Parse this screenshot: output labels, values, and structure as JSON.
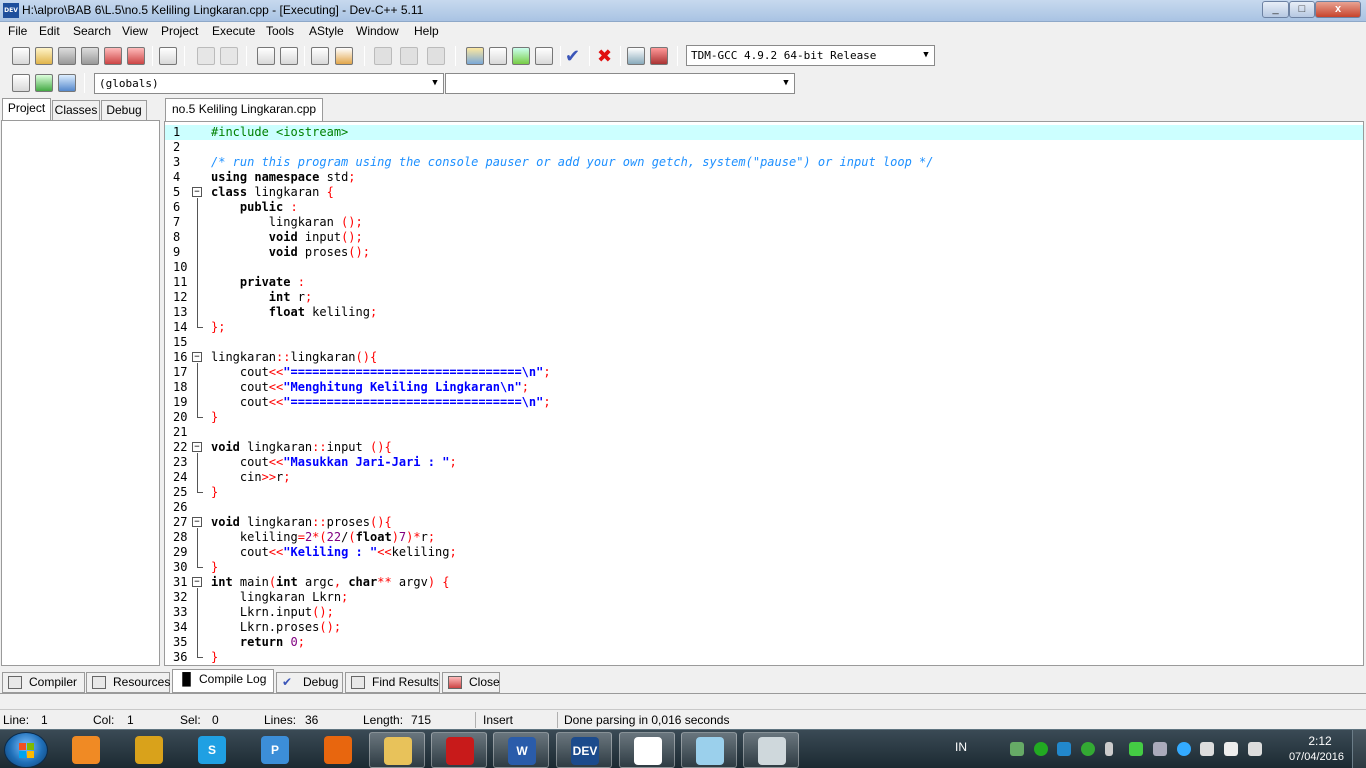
{
  "window": {
    "title": "H:\\alpro\\BAB 6\\L.5\\no.5 Keliling Lingkaran.cpp - [Executing] - Dev-C++ 5.11",
    "icon_text": "DEV",
    "min": "_",
    "max": "□",
    "close": "x"
  },
  "menu": [
    "File",
    "Edit",
    "Search",
    "View",
    "Project",
    "Execute",
    "Tools",
    "AStyle",
    "Window",
    "Help"
  ],
  "toolbar": {
    "compiler_select": "TDM-GCC 4.9.2 64-bit Release",
    "scope_select": "(globals)",
    "member_select": ""
  },
  "left_tabs": [
    "Project",
    "Classes",
    "Debug"
  ],
  "editor": {
    "tab_label": "no.5 Keliling Lingkaran.cpp",
    "current_line": 1
  },
  "code_lines": [
    "#include <iostream>",
    "",
    "/* run this program using the console pauser or add your own getch, system(\"pause\") or input loop */",
    "using namespace std;",
    "class lingkaran {",
    "    public :",
    "        lingkaran ();",
    "        void input();",
    "        void proses();",
    "",
    "    private :",
    "        int r;",
    "        float keliling;",
    "};",
    "",
    "lingkaran::lingkaran(){",
    "    cout<<\"================================\\n\";",
    "    cout<<\"Menghitung Keliling Lingkaran\\n\";",
    "    cout<<\"================================\\n\";",
    "}",
    "",
    "void lingkaran::input (){",
    "    cout<<\"Masukkan Jari-Jari : \";",
    "    cin>>r;",
    "}",
    "",
    "void lingkaran::proses(){",
    "    keliling=2*(22/(float)7)*r;",
    "    cout<<\"Keliling : \"<<keliling;",
    "}",
    "int main(int argc, char** argv) {",
    "    lingkaran Lkrn;",
    "    Lkrn.input();",
    "    Lkrn.proses();",
    "    return 0;",
    "}"
  ],
  "bottom_tabs": [
    "Compiler",
    "Resources",
    "Compile Log",
    "Debug",
    "Find Results",
    "Close"
  ],
  "status": {
    "line_label": "Line:",
    "line_value": "1",
    "col_label": "Col:",
    "col_value": "1",
    "sel_label": "Sel:",
    "sel_value": "0",
    "lines_label": "Lines:",
    "lines_value": "36",
    "length_label": "Length:",
    "length_value": "715",
    "mode": "Insert",
    "message": "Done parsing in 0,016 seconds"
  },
  "taskbar": {
    "apps": [
      {
        "name": "media-player-icon",
        "label": "",
        "color": "#f08a24"
      },
      {
        "name": "winamp-icon",
        "label": "",
        "color": "#d9a21b"
      },
      {
        "name": "skype-icon",
        "label": "S",
        "color": "#1fa0e3"
      },
      {
        "name": "app-p-icon",
        "label": "P",
        "color": "#3c8ed8"
      },
      {
        "name": "firefox-icon",
        "label": "",
        "color": "#e8660e"
      },
      {
        "name": "explorer-icon",
        "label": "",
        "color": "#e8c25a"
      },
      {
        "name": "acrobat-icon",
        "label": "",
        "color": "#c81a1a"
      },
      {
        "name": "word-icon",
        "label": "W",
        "color": "#2a5caa"
      },
      {
        "name": "devcpp-icon",
        "label": "DEV",
        "color": "#1c4b8c"
      },
      {
        "name": "dinosaur-app-icon",
        "label": "",
        "color": "#ffffff"
      },
      {
        "name": "paint-icon",
        "label": "",
        "color": "#9bd0ec"
      },
      {
        "name": "console-app-icon",
        "label": "",
        "color": "#cfd8dc"
      }
    ],
    "language": "IN",
    "time": "2:12",
    "date": "07/04/2016"
  }
}
